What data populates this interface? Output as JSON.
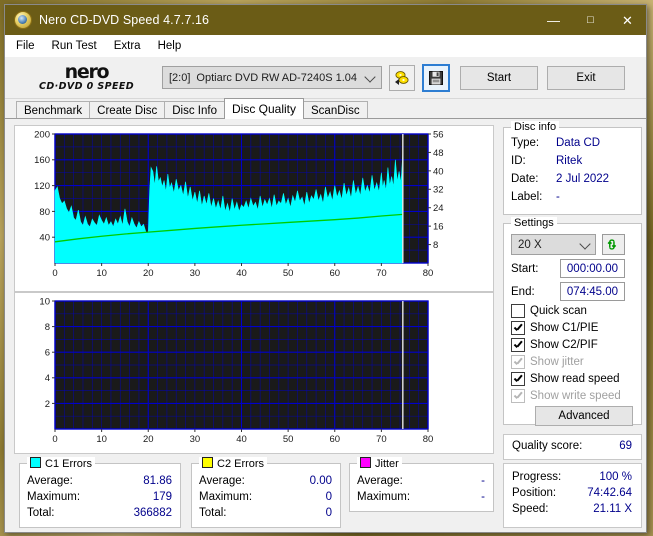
{
  "window": {
    "title": "Nero CD-DVD Speed 4.7.7.16",
    "icon": "nero-disc-icon",
    "minimize": "—",
    "maximize": "□",
    "close": "✕"
  },
  "menu": {
    "items": [
      "File",
      "Run Test",
      "Extra",
      "Help"
    ]
  },
  "toolbar": {
    "logo_line1": "nero",
    "logo_line2": "CD·DVD ⁠0 SPEED",
    "drive_index": "[2:0]",
    "drive_name": "Optiarc DVD RW AD-7240S 1.04",
    "icon_disc": "disc-speed-icon",
    "icon_save": "save-floppy-icon",
    "start_label": "Start",
    "exit_label": "Exit"
  },
  "tabs": [
    {
      "label": "Benchmark",
      "active": false
    },
    {
      "label": "Create Disc",
      "active": false
    },
    {
      "label": "Disc Info",
      "active": false
    },
    {
      "label": "Disc Quality",
      "active": true
    },
    {
      "label": "ScanDisc",
      "active": false
    }
  ],
  "disc_info": {
    "title": "Disc info",
    "fields": [
      {
        "label": "Type:",
        "value": "Data CD"
      },
      {
        "label": "ID:",
        "value": "Ritek"
      },
      {
        "label": "Date:",
        "value": "2 Jul 2022"
      },
      {
        "label": "Label:",
        "value": "-"
      }
    ]
  },
  "settings": {
    "title": "Settings",
    "speed": "20 X",
    "refresh_icon": "refresh-arrows-icon",
    "start_label": "Start:",
    "start_value": "000:00.00",
    "end_label": "End:",
    "end_value": "074:45.00",
    "checkboxes": [
      {
        "label": "Quick scan",
        "checked": false,
        "disabled": false
      },
      {
        "label": "Show C1/PIE",
        "checked": true,
        "disabled": false
      },
      {
        "label": "Show C2/PIF",
        "checked": true,
        "disabled": false
      },
      {
        "label": "Show jitter",
        "checked": true,
        "disabled": true
      },
      {
        "label": "Show read speed",
        "checked": true,
        "disabled": false
      },
      {
        "label": "Show write speed",
        "checked": true,
        "disabled": true
      }
    ],
    "advanced_label": "Advanced"
  },
  "quality": {
    "label": "Quality score:",
    "value": "69"
  },
  "status": {
    "rows": [
      {
        "label": "Progress:",
        "value": "100 %"
      },
      {
        "label": "Position:",
        "value": "74:42.64"
      },
      {
        "label": "Speed:",
        "value": "21.11 X"
      }
    ]
  },
  "stats": [
    {
      "title": "C1 Errors",
      "color": "#00ffff",
      "rows": [
        {
          "label": "Average:",
          "value": "81.86"
        },
        {
          "label": "Maximum:",
          "value": "179"
        },
        {
          "label": "Total:",
          "value": "366882"
        }
      ]
    },
    {
      "title": "C2 Errors",
      "color": "#ffff00",
      "rows": [
        {
          "label": "Average:",
          "value": "0.00"
        },
        {
          "label": "Maximum:",
          "value": "0"
        },
        {
          "label": "Total:",
          "value": "0"
        }
      ]
    },
    {
      "title": "Jitter",
      "color": "#ff00ff",
      "rows": [
        {
          "label": "Average:",
          "value": "-"
        },
        {
          "label": "Maximum:",
          "value": "-"
        }
      ]
    }
  ],
  "chart_data": [
    {
      "id": "c1-chart",
      "type": "area",
      "title": "",
      "xlabel": "",
      "ylabel": "",
      "xlim": [
        0,
        80
      ],
      "ylim": [
        0,
        200
      ],
      "y2lim": [
        0,
        56
      ],
      "grid": true,
      "xticks": [
        0,
        10,
        20,
        30,
        40,
        50,
        60,
        70,
        80
      ],
      "yticks": [
        40,
        80,
        120,
        160,
        200
      ],
      "y2ticks": [
        8,
        16,
        24,
        32,
        40,
        48,
        56
      ],
      "bg": "#1a1a1a",
      "grid_color": "#0000cc",
      "scan_end_x": 74.6,
      "series": [
        {
          "name": "C1 Errors",
          "color": "#00ffff",
          "kind": "area",
          "axis": "left",
          "x": [
            0,
            0.5,
            1,
            1.5,
            2,
            2.5,
            3,
            3.5,
            4,
            4.5,
            5,
            5.5,
            6,
            6.5,
            7,
            7.5,
            8,
            8.5,
            9,
            9.5,
            10,
            10.5,
            11,
            11.5,
            12,
            12.5,
            13,
            13.5,
            14,
            14.5,
            15,
            15.5,
            16,
            16.5,
            17,
            17.5,
            18,
            18.5,
            19,
            19.5,
            20,
            20.3,
            20.6,
            21,
            21.4,
            21.8,
            22.2,
            22.6,
            23,
            23.4,
            23.8,
            24.2,
            24.6,
            25,
            25.5,
            26,
            26.5,
            27,
            27.5,
            28,
            28.5,
            29,
            29.5,
            30,
            30.5,
            31,
            31.5,
            32,
            32.5,
            33,
            33.5,
            34,
            34.5,
            35,
            35.5,
            36,
            36.5,
            37,
            37.5,
            38,
            38.5,
            39,
            39.5,
            40,
            40.5,
            41,
            41.5,
            42,
            42.5,
            43,
            43.5,
            44,
            44.5,
            45,
            45.5,
            46,
            46.5,
            47,
            47.5,
            48,
            48.5,
            49,
            49.5,
            50,
            50.5,
            51,
            51.5,
            52,
            52.5,
            53,
            53.5,
            54,
            54.5,
            55,
            55.5,
            56,
            56.5,
            57,
            57.5,
            58,
            58.5,
            59,
            59.5,
            60,
            60.5,
            61,
            61.5,
            62,
            62.5,
            63,
            63.5,
            64,
            64.5,
            65,
            65.5,
            66,
            66.5,
            67,
            67.5,
            68,
            68.5,
            69,
            69.5,
            70,
            70.3,
            70.6,
            71,
            71.4,
            71.8,
            72.2,
            72.6,
            73,
            73.4,
            73.8,
            74.2,
            74.6
          ],
          "y": [
            112,
            118,
            100,
            92,
            96,
            84,
            78,
            88,
            70,
            66,
            82,
            64,
            58,
            72,
            60,
            56,
            68,
            62,
            58,
            74,
            66,
            60,
            70,
            58,
            64,
            56,
            68,
            60,
            72,
            58,
            84,
            64,
            56,
            70,
            60,
            54,
            64,
            56,
            60,
            48,
            46,
            112,
            148,
            142,
            120,
            150,
            126,
            132,
            118,
            128,
            110,
            138,
            116,
            124,
            108,
            130,
            112,
            120,
            104,
            126,
            100,
            118,
            96,
            110,
            92,
            112,
            88,
            104,
            90,
            108,
            86,
            100,
            84,
            96,
            82,
            104,
            80,
            92,
            78,
            100,
            82,
            94,
            80,
            90,
            86,
            96,
            84,
            100,
            88,
            94,
            82,
            104,
            86,
            98,
            90,
            100,
            84,
            106,
            88,
            96,
            92,
            108,
            90,
            100,
            86,
            104,
            94,
            112,
            96,
            102,
            88,
            110,
            92,
            104,
            98,
            114,
            96,
            106,
            92,
            118,
            100,
            110,
            96,
            120,
            102,
            112,
            98,
            124,
            104,
            116,
            100,
            128,
            106,
            118,
            104,
            132,
            110,
            120,
            108,
            136,
            112,
            124,
            110,
            140,
            116,
            128,
            112,
            148,
            120,
            134,
            118,
            160,
            126,
            142,
            124,
            170
          ]
        },
        {
          "name": "Read speed",
          "color": "#00cc00",
          "kind": "line",
          "axis": "right",
          "x": [
            0,
            5,
            10,
            15,
            20,
            25,
            30,
            35,
            40,
            45,
            50,
            55,
            60,
            65,
            70,
            74.6
          ],
          "y": [
            9.2,
            10.5,
            11.6,
            12.6,
            13.4,
            14.2,
            15.0,
            15.7,
            16.4,
            17.0,
            17.6,
            18.2,
            18.8,
            19.5,
            20.4,
            21.11
          ]
        }
      ]
    },
    {
      "id": "c2-chart",
      "type": "area",
      "title": "",
      "xlabel": "",
      "ylabel": "",
      "xlim": [
        0,
        80
      ],
      "ylim": [
        0,
        10
      ],
      "grid": true,
      "xticks": [
        0,
        10,
        20,
        30,
        40,
        50,
        60,
        70,
        80
      ],
      "yticks": [
        2,
        4,
        6,
        8,
        10
      ],
      "bg": "#1a1a1a",
      "grid_color": "#0000cc",
      "scan_end_x": 74.6,
      "series": [
        {
          "name": "C2 Errors",
          "color": "#ffff00",
          "kind": "area",
          "axis": "left",
          "x": [],
          "y": []
        }
      ]
    }
  ]
}
